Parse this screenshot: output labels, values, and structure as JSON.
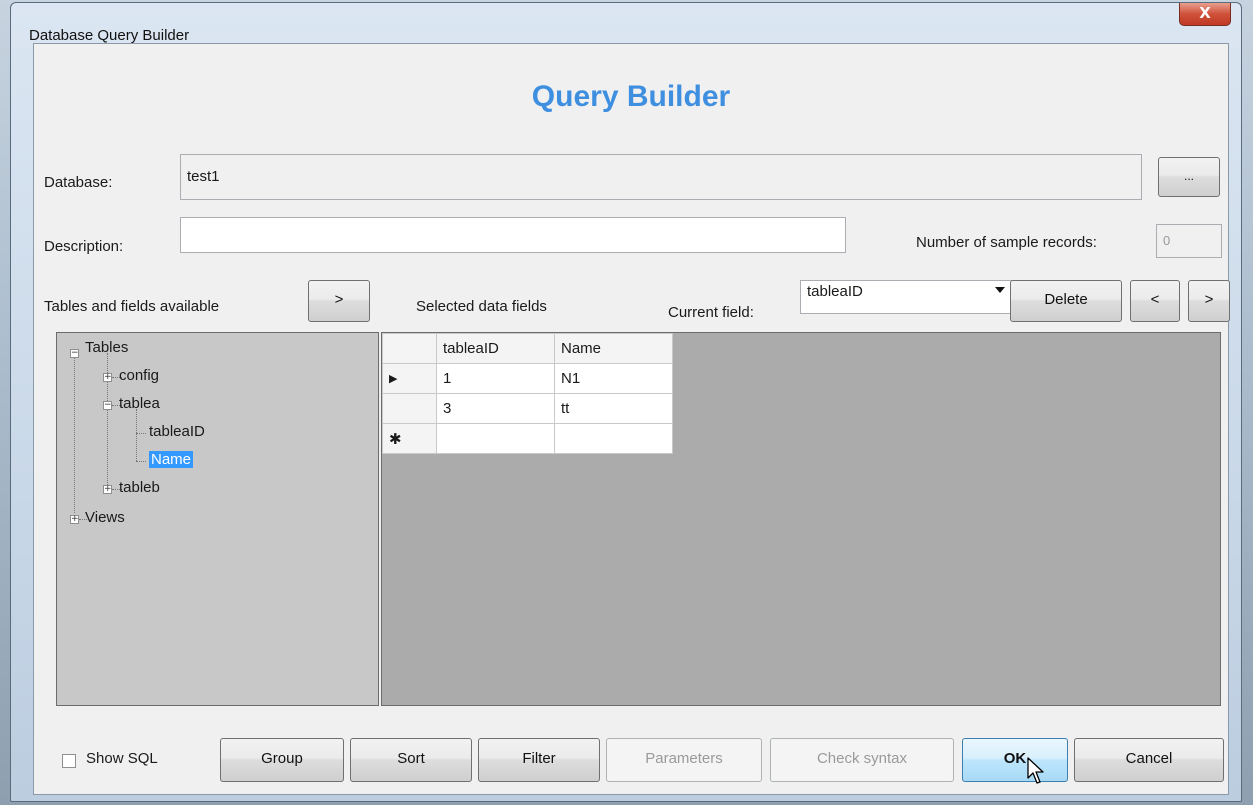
{
  "window": {
    "title": "Database Query Builder",
    "close_glyph": "X"
  },
  "heading": "Query Builder",
  "database": {
    "label": "Database:",
    "value": "test1",
    "browse_label": "..."
  },
  "description": {
    "label": "Description:",
    "value": ""
  },
  "sample_records": {
    "label": "Number of sample records:",
    "value": "0"
  },
  "tables_label": "Tables and fields available",
  "add_field_label": ">",
  "selected_label": "Selected data fields",
  "current_field": {
    "label": "Current field:",
    "value": "tableaID"
  },
  "delete_label": "Delete",
  "move_left_label": "<",
  "move_right_label": ">",
  "tree": {
    "root": "Tables",
    "items": [
      "config",
      "tablea",
      "tableaID",
      "Name",
      "tableb",
      "Views"
    ]
  },
  "grid": {
    "columns": [
      "tableaID",
      "Name"
    ],
    "rows": [
      {
        "marker": "▶",
        "cells": [
          "1",
          "N1"
        ]
      },
      {
        "marker": "",
        "cells": [
          "3",
          "tt"
        ]
      },
      {
        "marker": "✱",
        "cells": [
          "",
          ""
        ]
      }
    ]
  },
  "footer": {
    "show_sql_label": "Show SQL",
    "group_label": "Group",
    "sort_label": "Sort",
    "filter_label": "Filter",
    "parameters_label": "Parameters",
    "check_syntax_label": "Check syntax",
    "ok_label": "OK",
    "cancel_label": "Cancel"
  },
  "colors": {
    "heading": "#3f8fe0",
    "selection": "#3399ff",
    "grid_background": "#ababab"
  }
}
